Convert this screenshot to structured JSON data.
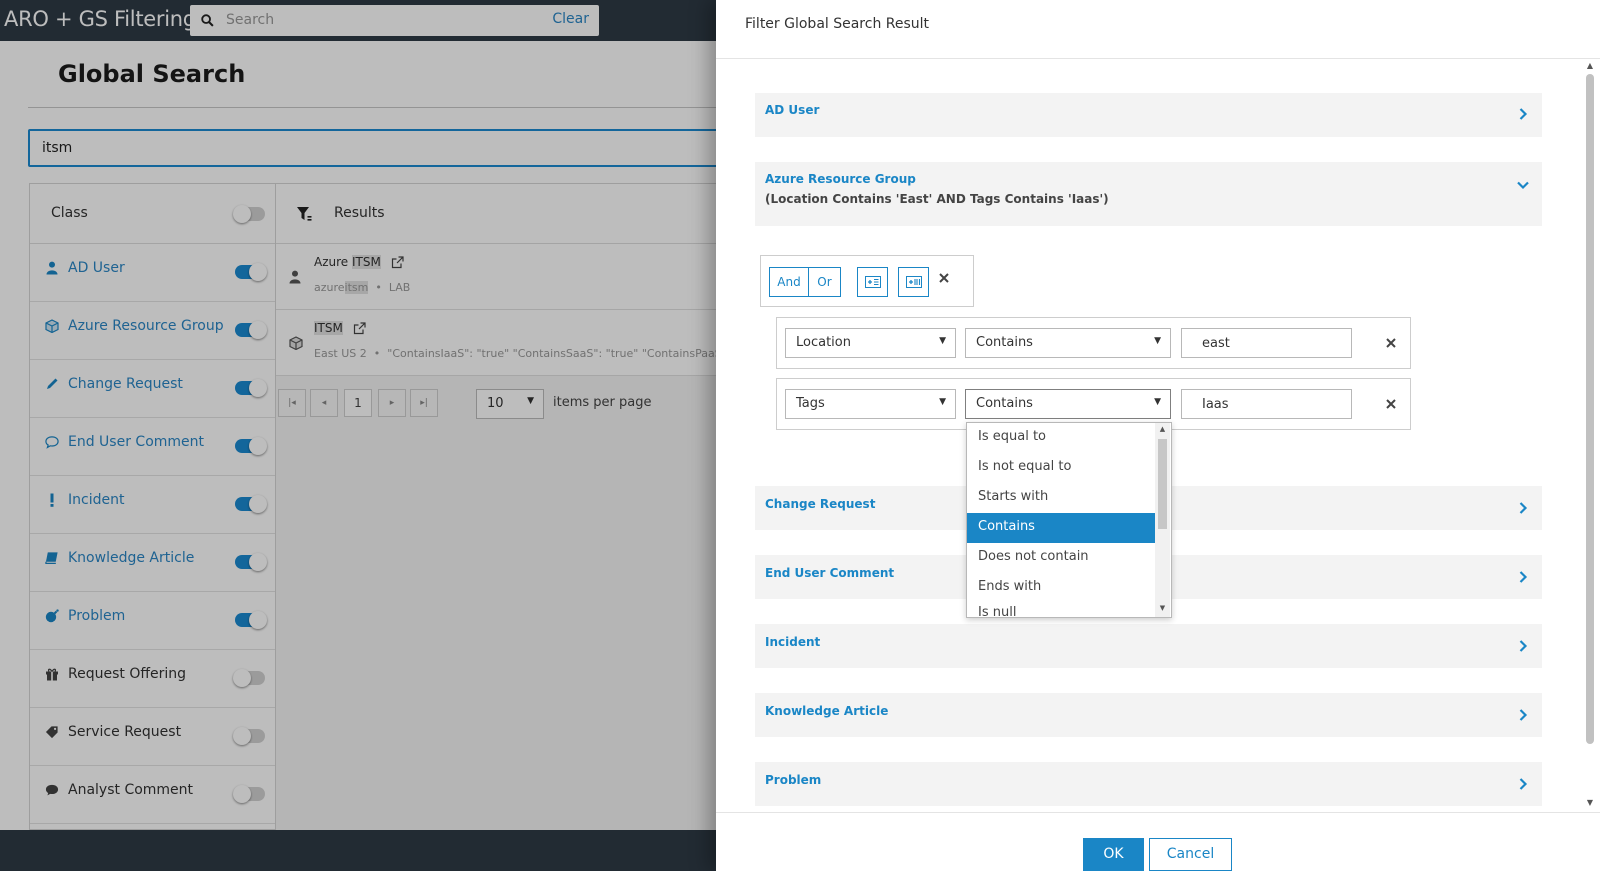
{
  "app": {
    "title": "ARO + GS Filtering",
    "search_placeholder": "Search",
    "clear_label": "Clear"
  },
  "global_search": {
    "title": "Global Search",
    "query": "itsm"
  },
  "class_panel": {
    "header": "Class",
    "header_toggle_on": false,
    "items": [
      {
        "label": "AD User",
        "icon": "user-icon",
        "enabled": true
      },
      {
        "label": "Azure Resource Group",
        "icon": "cube-icon",
        "enabled": true
      },
      {
        "label": "Change Request",
        "icon": "pencil-icon",
        "enabled": true
      },
      {
        "label": "End User Comment",
        "icon": "comment-icon",
        "enabled": true
      },
      {
        "label": "Incident",
        "icon": "exclamation-icon",
        "enabled": true
      },
      {
        "label": "Knowledge Article",
        "icon": "book-icon",
        "enabled": true
      },
      {
        "label": "Problem",
        "icon": "bomb-icon",
        "enabled": true
      },
      {
        "label": "Request Offering",
        "icon": "gift-icon",
        "enabled": false
      },
      {
        "label": "Service Request",
        "icon": "tag-icon",
        "enabled": false
      },
      {
        "label": "Analyst Comment",
        "icon": "comment-filled-icon",
        "enabled": false
      }
    ]
  },
  "results": {
    "header": "Results",
    "rows": [
      {
        "title_prefix": "Azure ",
        "title_highlight": "ITSM",
        "sub_prefix": "azure",
        "sub_highlight": "itsm",
        "sub_sep": "•",
        "sub_rest": "LAB"
      },
      {
        "title_prefix": "",
        "title_highlight": "ITSM",
        "sub_prefix": "East US 2",
        "sub_highlight": "",
        "sub_sep": "•",
        "sub_rest": "\"ContainsIaaS\": \"true\" \"ContainsSaaS\": \"true\" \"ContainsPaaS\": \"t"
      }
    ],
    "pager": {
      "page": "1",
      "page_size": "10",
      "items_per_page_label": "items per page"
    }
  },
  "dialog": {
    "title": "Filter Global Search Result",
    "sections": {
      "ad_user": "AD User",
      "azure_rg": "Azure Resource Group",
      "azure_rg_summary": "(Location Contains 'East' AND Tags Contains 'Iaas')",
      "change_request": "Change Request",
      "end_user_comment": "End User Comment",
      "incident": "Incident",
      "knowledge_article": "Knowledge Article",
      "problem": "Problem"
    },
    "logic": {
      "and_label": "And",
      "or_label": "Or"
    },
    "conditions": [
      {
        "field": "Location",
        "operator": "Contains",
        "value": "east"
      },
      {
        "field": "Tags",
        "operator": "Contains",
        "value": "Iaas"
      }
    ],
    "operator_options": [
      "Is equal to",
      "Is not equal to",
      "Starts with",
      "Contains",
      "Does not contain",
      "Ends with",
      "Is null"
    ],
    "selected_operator": "Contains",
    "ok_label": "OK",
    "cancel_label": "Cancel"
  },
  "colors": {
    "accent": "#1a86c6",
    "topbar": "#2e3a45",
    "section_bg": "#f3f3f3"
  }
}
